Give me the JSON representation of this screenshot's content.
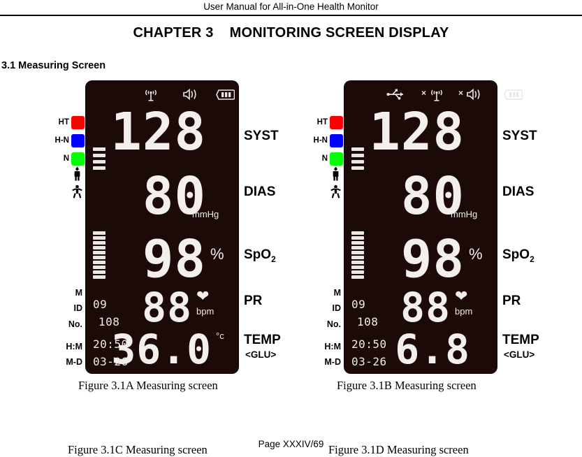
{
  "document": {
    "header": "User Manual for All-in-One Health Monitor",
    "chapter_title": "CHAPTER 3    MONITORING SCREEN DISPLAY",
    "section_title": "3.1 Measuring Screen",
    "page_footer": "Page XXXIV/69"
  },
  "captions": {
    "figure_a": "Figure 3.1A Measuring screen",
    "figure_b": "Figure 3.1B Measuring screen",
    "figure_c": "Figure 3.1C Measuring screen",
    "figure_d": "Figure 3.1D Measuring screen"
  },
  "colors": {
    "lcd_background": "#1b0a08",
    "segment": "#f2efed",
    "ht": "#ff0000",
    "h_n": "#0000ff",
    "n": "#00ff00"
  },
  "side_labels": {
    "levels": [
      {
        "label": "HT",
        "color": "#ff0000"
      },
      {
        "label": "H-N",
        "color": "#0000ff"
      },
      {
        "label": "N",
        "color": "#00ff00"
      }
    ],
    "pictograms": [
      {
        "name": "adult-standing-icon",
        "glyph": "ᾜD"
      },
      {
        "name": "child-arms-out-icon",
        "glyph": "\u0000"
      }
    ]
  },
  "measure_labels": {
    "syst": "SYST",
    "dias": "DIAS",
    "spo2_text": "SpO",
    "spo2_sub": "2",
    "pr": "PR",
    "temp": "TEMP",
    "glu": "<GLU>"
  },
  "units": {
    "mmhg": "mmHg",
    "percent": "%",
    "bpm": "bpm",
    "celsius": "°c"
  },
  "meta_labels": {
    "m": "M",
    "id": "ID",
    "no": "No.",
    "hm": "H:M",
    "md": "M-D"
  },
  "screen_a": {
    "status_icons": [
      {
        "name": "signal-antenna-icon",
        "disabled": false
      },
      {
        "name": "speaker-sound-icon",
        "disabled": false
      },
      {
        "name": "battery-icon",
        "bars": 3
      }
    ],
    "syst": "128",
    "dias": "80",
    "spo2": "98",
    "pr": "88",
    "temp": "36.0",
    "temp_unit_shown": "°c",
    "id_value": "09",
    "no_value": "108",
    "time_value": "20:50",
    "date_value": "03-26",
    "cuff_bars": 4,
    "pulse_bars": 10
  },
  "screen_b": {
    "status_icons": [
      {
        "name": "usb-icon",
        "disabled": false
      },
      {
        "name": "signal-antenna-icon",
        "disabled": true,
        "prefix": "×"
      },
      {
        "name": "speaker-sound-icon",
        "disabled": true,
        "prefix": "×"
      },
      {
        "name": "battery-icon",
        "bars": 3
      }
    ],
    "syst": "128",
    "dias": "80",
    "spo2": "98",
    "pr": "88",
    "temp": "6.8",
    "temp_unit_shown": "",
    "id_value": "09",
    "no_value": "108",
    "time_value": "20:50",
    "date_value": "03-26",
    "cuff_bars": 4,
    "pulse_bars": 10
  }
}
